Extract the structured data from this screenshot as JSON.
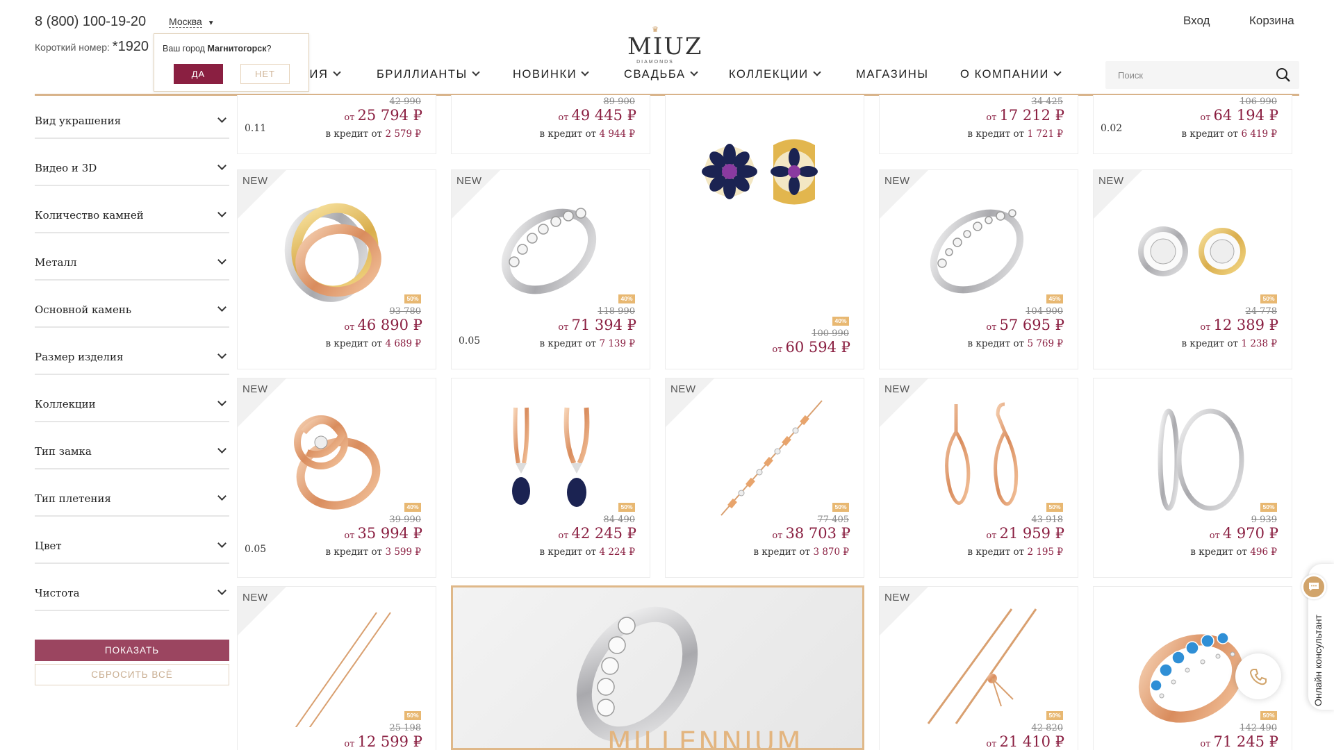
{
  "header": {
    "phone": "8 (800) 100-19-20",
    "short_label": "Короткий номер:",
    "short_number": "*1920",
    "city": "Москва",
    "logo_text": "MIUZ",
    "logo_sub": "DIAMONDS",
    "login": "Вход",
    "cart": "Корзина",
    "search_placeholder": "Поиск",
    "accent_color": "#8a1f41",
    "gold_color": "#d8b38a"
  },
  "city_popup": {
    "question_prefix": "Ваш город",
    "city": "Магнитогорск",
    "question_suffix": "?",
    "yes": "ДА",
    "no": "НЕТ"
  },
  "nav": [
    {
      "label": "НИЯ"
    },
    {
      "label": "БРИЛЛИАНТЫ"
    },
    {
      "label": "НОВИНКИ"
    },
    {
      "label": "СВАДЬБА"
    },
    {
      "label": "КОЛЛЕКЦИИ"
    },
    {
      "label": "МАГАЗИНЫ"
    },
    {
      "label": "О КОМПАНИИ"
    }
  ],
  "filters": [
    "Вид украшения",
    "Видео и 3D",
    "Количество камней",
    "Металл",
    "Основной камень",
    "Размер изделия",
    "Коллекции",
    "Тип замка",
    "Тип плетения",
    "Цвет",
    "Чистота"
  ],
  "filter_buttons": {
    "show": "ПОКАЗАТЬ",
    "reset": "СБРОСИТЬ ВСЁ"
  },
  "labels": {
    "new": "NEW",
    "from": "от",
    "credit": "в кредит от",
    "currency": "₽"
  },
  "top_row": [
    {
      "old": "42 990",
      "price": "25 794",
      "credit": "2 579",
      "carat": "0.11"
    },
    {
      "old": "89 900",
      "price": "49 445",
      "credit": "4 944",
      "carat": ""
    },
    {
      "old": "34 425",
      "price": "17 212",
      "credit": "1 721",
      "carat": ""
    },
    {
      "old": "106 990",
      "price": "64 194",
      "credit": "6 419",
      "carat": "0.02"
    }
  ],
  "products": [
    {
      "new": true,
      "image": "three-tone-rolling-ring",
      "discount": "50%",
      "old": "93 780",
      "price": "46 890",
      "credit": "4 689",
      "carat": ""
    },
    {
      "new": true,
      "image": "diamond-band-ring",
      "discount": "40%",
      "old": "118 990",
      "price": "71 394",
      "credit": "7 139",
      "carat": "0.05"
    },
    {
      "new": false,
      "image": "sapphire-flower-earrings",
      "discount": "40%",
      "old": "100 990",
      "price": "60 594",
      "credit": "",
      "carat": ""
    },
    {
      "new": true,
      "image": "diamond-band-ring",
      "discount": "45%",
      "old": "104 900",
      "price": "57 695",
      "credit": "5 769",
      "carat": ""
    },
    {
      "new": true,
      "image": "halo-stud-earrings",
      "discount": "50%",
      "old": "24 778",
      "price": "12 389",
      "credit": "1 238",
      "carat": ""
    },
    {
      "new": true,
      "image": "rose-gold-knot-ring",
      "discount": "40%",
      "old": "39 990",
      "price": "35 994",
      "credit": "3 599",
      "carat": "0.05"
    },
    {
      "new": false,
      "image": "sapphire-drop-earrings",
      "discount": "50%",
      "old": "84 490",
      "price": "42 245",
      "credit": "4 224",
      "carat": ""
    },
    {
      "new": true,
      "image": "station-bracelet",
      "discount": "50%",
      "old": "77 405",
      "price": "38 703",
      "credit": "3 870",
      "carat": ""
    },
    {
      "new": true,
      "image": "twisted-drop-earrings",
      "discount": "50%",
      "old": "43 918",
      "price": "21 959",
      "credit": "2 195",
      "carat": ""
    },
    {
      "new": false,
      "image": "silver-hoop-earrings",
      "discount": "50%",
      "old": "9 939",
      "price": "4 970",
      "credit": "496",
      "carat": ""
    },
    {
      "new": true,
      "image": "gold-chain",
      "discount": "50%",
      "old": "25 198",
      "price": "12 599",
      "credit": "",
      "carat": ""
    },
    {
      "new": true,
      "image": "slider-chain-bracelet",
      "discount": "50%",
      "old": "42 820",
      "price": "21 410",
      "credit": "",
      "carat": ""
    },
    {
      "new": false,
      "image": "blue-topaz-ring",
      "discount": "50%",
      "old": "142 490",
      "price": "71 245",
      "credit": "",
      "carat": ""
    }
  ],
  "banner": {
    "title": "MILLENNIUM"
  },
  "consultant": {
    "label": "Онлайн консультант"
  }
}
